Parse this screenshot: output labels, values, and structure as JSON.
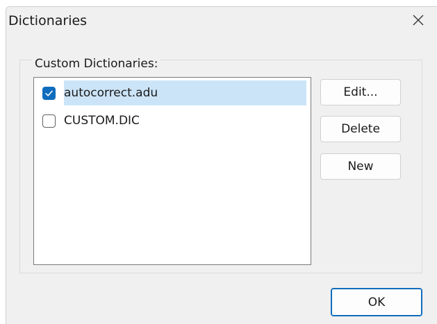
{
  "window": {
    "title": "Dictionaries",
    "close_icon": "close-icon"
  },
  "custom_dictionaries": {
    "label": "Custom Dictionaries:",
    "items": [
      {
        "label": "autocorrect.adu",
        "checked": true,
        "selected": true
      },
      {
        "label": "CUSTOM.DIC",
        "checked": false,
        "selected": false
      }
    ]
  },
  "buttons": {
    "edit": "Edit...",
    "delete": "Delete",
    "new": "New",
    "ok": "OK"
  },
  "colors": {
    "accent": "#0f6cbd",
    "selection": "#cce4f7",
    "dialog_bg": "#f0f0f0"
  }
}
